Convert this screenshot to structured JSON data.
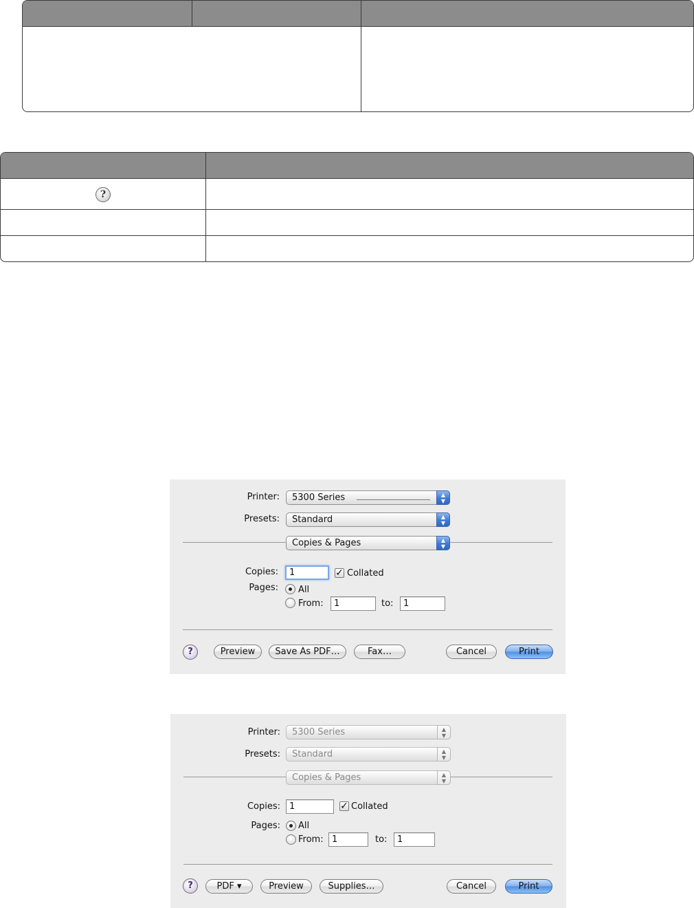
{
  "dialog_top": {
    "printer_label": "Printer:",
    "printer_value": "5300 Series",
    "presets_label": "Presets:",
    "presets_value": "Standard",
    "panel_value": "Copies & Pages",
    "copies_label": "Copies:",
    "copies_value": "1",
    "collated_label": "Collated",
    "collated_checked": true,
    "pages_label": "Pages:",
    "all_label": "All",
    "from_label": "From:",
    "from_value": "1",
    "to_label": "to:",
    "to_value": "1",
    "help_label": "?",
    "buttons": {
      "preview": "Preview",
      "save_pdf": "Save As PDF…",
      "fax": "Fax…",
      "cancel": "Cancel",
      "print": "Print"
    }
  },
  "dialog_bottom": {
    "printer_label": "Printer:",
    "printer_value": "5300 Series",
    "presets_label": "Presets:",
    "presets_value": "Standard",
    "panel_value": "Copies & Pages",
    "copies_label": "Copies:",
    "copies_value": "1",
    "collated_label": "Collated",
    "collated_checked": true,
    "pages_label": "Pages:",
    "all_label": "All",
    "from_label": "From:",
    "from_value": "1",
    "to_label": "to:",
    "to_value": "1",
    "help_label": "?",
    "buttons": {
      "pdf": "PDF ▾",
      "preview": "Preview",
      "supplies": "Supplies…",
      "cancel": "Cancel",
      "print": "Print"
    }
  },
  "help_icon_glyph": "?",
  "colors": {
    "table_header": "#8c8c8c",
    "dialog_bg": "#ececec",
    "primary_button": "#6aa4ee"
  }
}
